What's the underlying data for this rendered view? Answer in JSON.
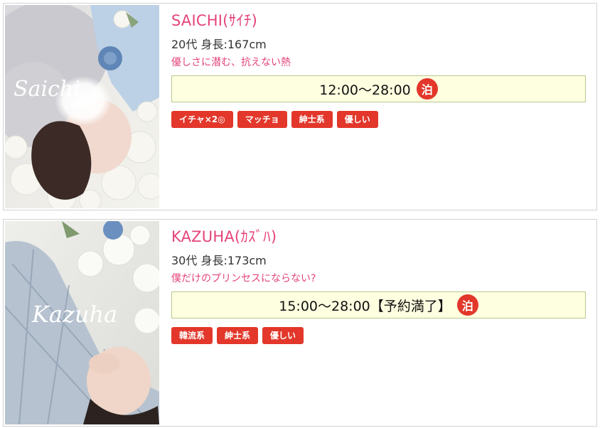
{
  "colors": {
    "name": "#e4447a",
    "catch": "#e4447a",
    "tag_bg": "#e2372a",
    "schedule_bg": "#fefee0",
    "schedule_border": "#b9c98e"
  },
  "casts": [
    {
      "name": "SAICHI(ｻｲﾁ)",
      "meta": "20代 身長:167cm",
      "catch": "優しさに潜む、抗えない熱",
      "schedule": "12:00〜28:00",
      "stay_badge": "泊",
      "photo_script": "Saichi",
      "tags": [
        "イチャ×2◎",
        "マッチョ",
        "紳士系",
        "優しい"
      ]
    },
    {
      "name": "KAZUHA(ｶｽﾞﾊ)",
      "meta": "30代 身長:173cm",
      "catch": "僕だけのプリンセスにならない?",
      "schedule": "15:00〜28:00【予約満了】",
      "stay_badge": "泊",
      "photo_script": "Kazuha",
      "tags": [
        "韓流系",
        "紳士系",
        "優しい"
      ]
    }
  ]
}
